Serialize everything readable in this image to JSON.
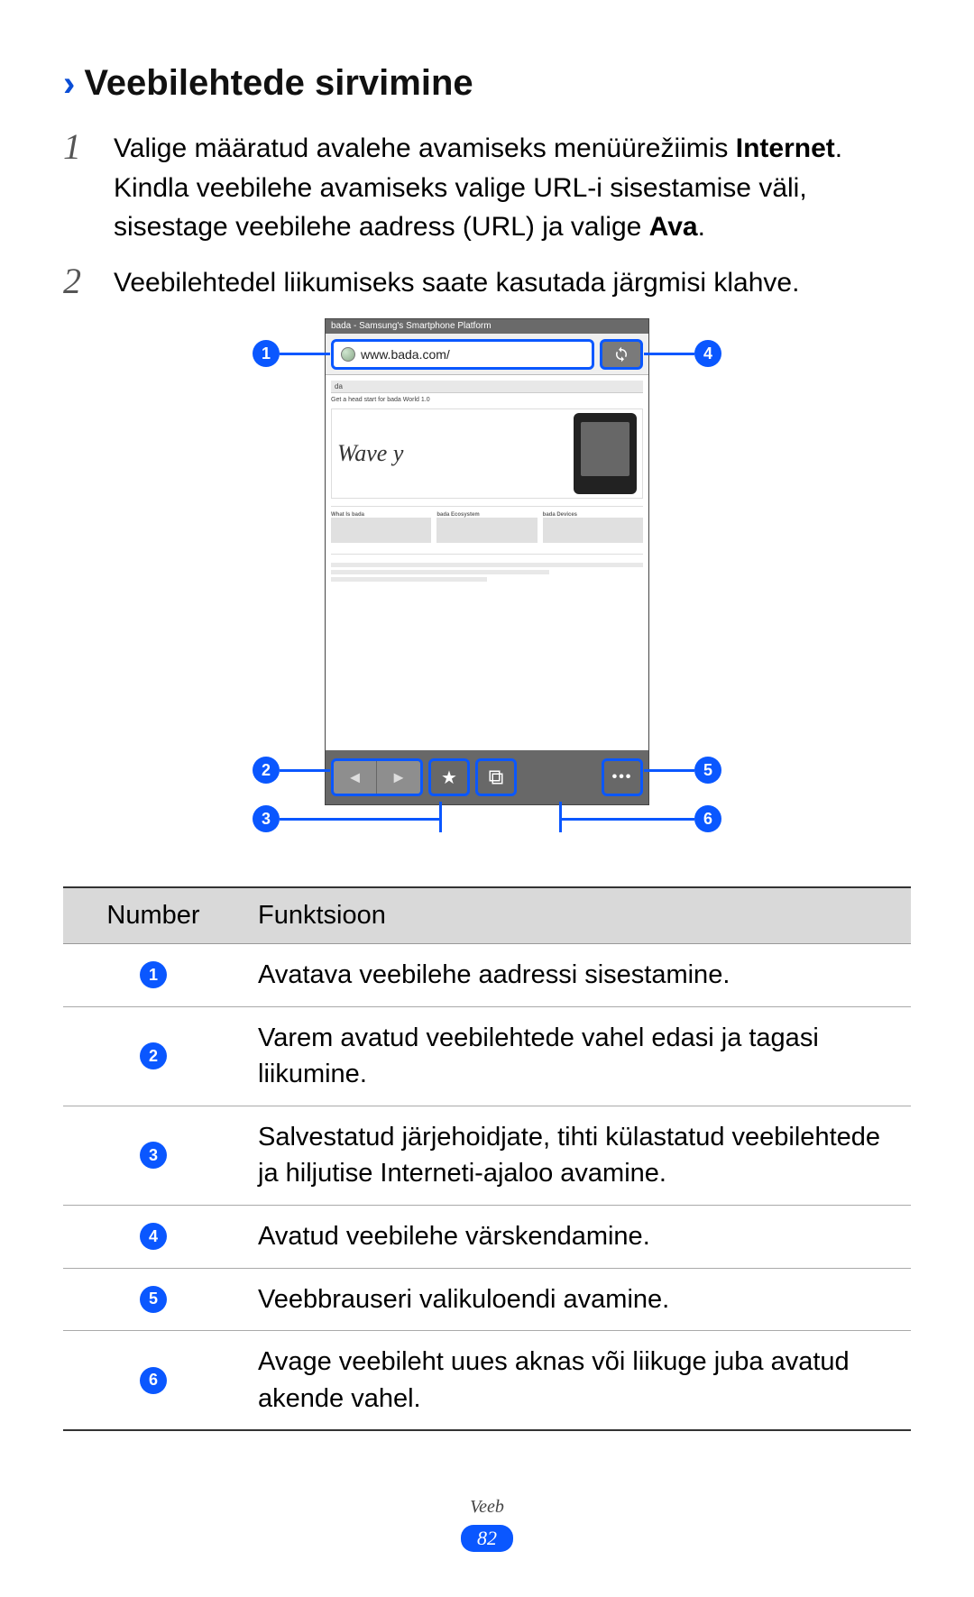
{
  "heading": "Veebilehtede sirvimine",
  "steps": [
    {
      "num": "1",
      "parts": [
        {
          "t": "Valige määratud avalehe avamiseks menüürežiimis ",
          "b": false
        },
        {
          "t": "Internet",
          "b": true
        },
        {
          "t": ". Kindla veebilehe avamiseks valige URL-i sisestamise väli, sisestage veebilehe aadress (URL) ja valige ",
          "b": false
        },
        {
          "t": "Ava",
          "b": true
        },
        {
          "t": ".",
          "b": false
        }
      ]
    },
    {
      "num": "2",
      "parts": [
        {
          "t": "Veebilehtedel liikumiseks saate kasutada järgmisi klahve.",
          "b": false
        }
      ]
    }
  ],
  "screenshot": {
    "titlebar": "bada - Samsung's Smartphone Platform",
    "url": "www.bada.com/",
    "tabs": "da",
    "tagline": "Get a head start for bada World 1.0",
    "wave": "Wave y",
    "col1_title": "What Is bada",
    "col2_title": "bada Ecosystem",
    "col3_title": "bada Devices"
  },
  "callouts": {
    "c1": "1",
    "c2": "2",
    "c3": "3",
    "c4": "4",
    "c5": "5",
    "c6": "6"
  },
  "table": {
    "head_num": "Number",
    "head_func": "Funktsioon",
    "rows": [
      {
        "n": "1",
        "f": "Avatava veebilehe aadressi sisestamine."
      },
      {
        "n": "2",
        "f": "Varem avatud veebilehtede vahel edasi ja tagasi liikumine."
      },
      {
        "n": "3",
        "f": "Salvestatud järjehoidjate, tihti külastatud veebilehtede ja hiljutise Interneti-ajaloo avamine."
      },
      {
        "n": "4",
        "f": "Avatud veebilehe värskendamine."
      },
      {
        "n": "5",
        "f": "Veebbrauseri valikuloendi avamine."
      },
      {
        "n": "6",
        "f": "Avage veebileht uues aknas või liikuge juba avatud akende vahel."
      }
    ]
  },
  "footer_label": "Veeb",
  "page_number": "82"
}
